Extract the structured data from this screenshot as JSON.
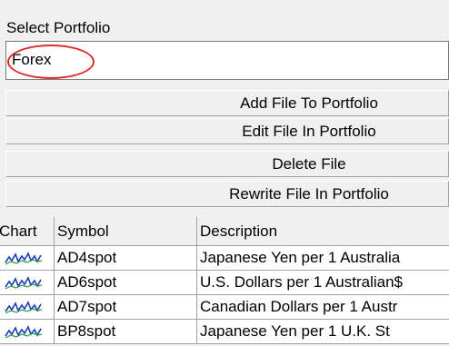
{
  "select_portfolio": {
    "label": "Select Portfolio",
    "value": "Forex",
    "annotation_color": "#e02a2a"
  },
  "buttons": {
    "add": "Add File To Portfolio",
    "edit": "Edit File In Portfolio",
    "delete": "Delete File",
    "rewrite": "Rewrite File In Portfolio"
  },
  "table": {
    "columns": [
      "Chart",
      "Symbol",
      "Description"
    ],
    "rows": [
      {
        "chart_icon": "mini-chart-icon",
        "symbol": "AD4spot",
        "description": "Japanese Yen per 1 Australia"
      },
      {
        "chart_icon": "mini-chart-icon",
        "symbol": "AD6spot",
        "description": "U.S. Dollars per 1 Australian$"
      },
      {
        "chart_icon": "mini-chart-icon",
        "symbol": "AD7spot",
        "description": "Canadian Dollars per 1 Austr"
      },
      {
        "chart_icon": "mini-chart-icon",
        "symbol": "BP8spot",
        "description": "Japanese Yen per 1 U.K. St"
      }
    ]
  }
}
